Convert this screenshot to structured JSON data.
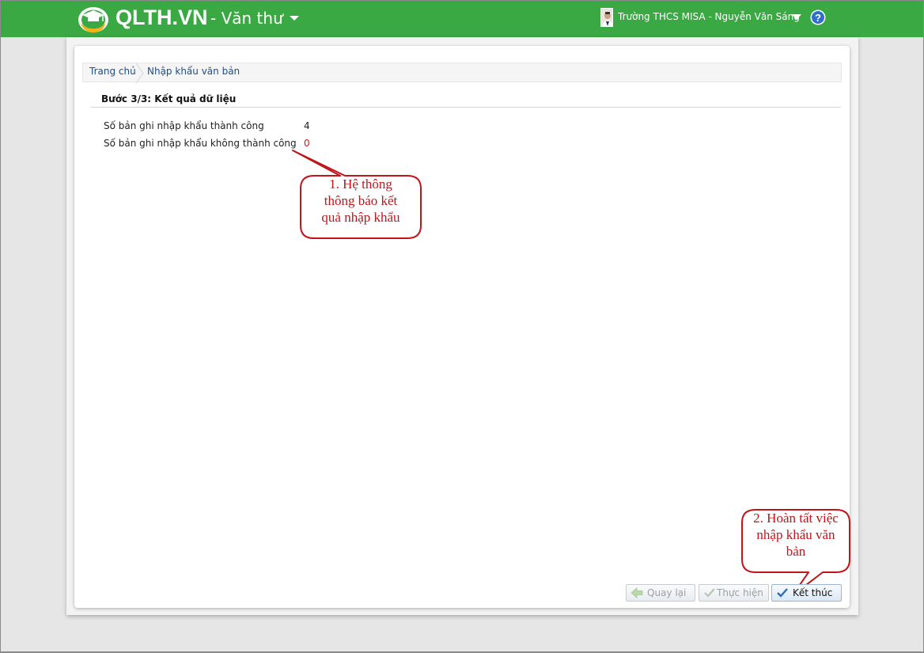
{
  "header": {
    "brand": "QLTH.VN",
    "module": "- Văn thư",
    "user": "Trường THCS MISA - Nguyễn Văn Sáng",
    "help_icon": "question-circle-icon",
    "colors": {
      "bar": "#3aa843"
    }
  },
  "breadcrumb": {
    "home": "Trang chủ",
    "current": "Nhập khẩu văn bản"
  },
  "step": {
    "title": "Bước 3/3: Kết quả dữ liệu"
  },
  "results": {
    "success_label": "Số bản ghi nhập khẩu thành công",
    "success_value": "4",
    "fail_label": "Số bản ghi nhập khẩu không thành công",
    "fail_value": "0"
  },
  "callouts": {
    "note1_line1": "1. Hệ thông",
    "note1_line2": "thông báo kết",
    "note1_line3": "quả nhập khẩu",
    "note2_line1": "2. Hoàn tất việc",
    "note2_line2": "nhập khẩu văn",
    "note2_line3": "bản",
    "color": "#c0151b"
  },
  "buttons": {
    "back": "Quay lại",
    "execute": "Thực hiện",
    "finish": "Kết thúc"
  }
}
